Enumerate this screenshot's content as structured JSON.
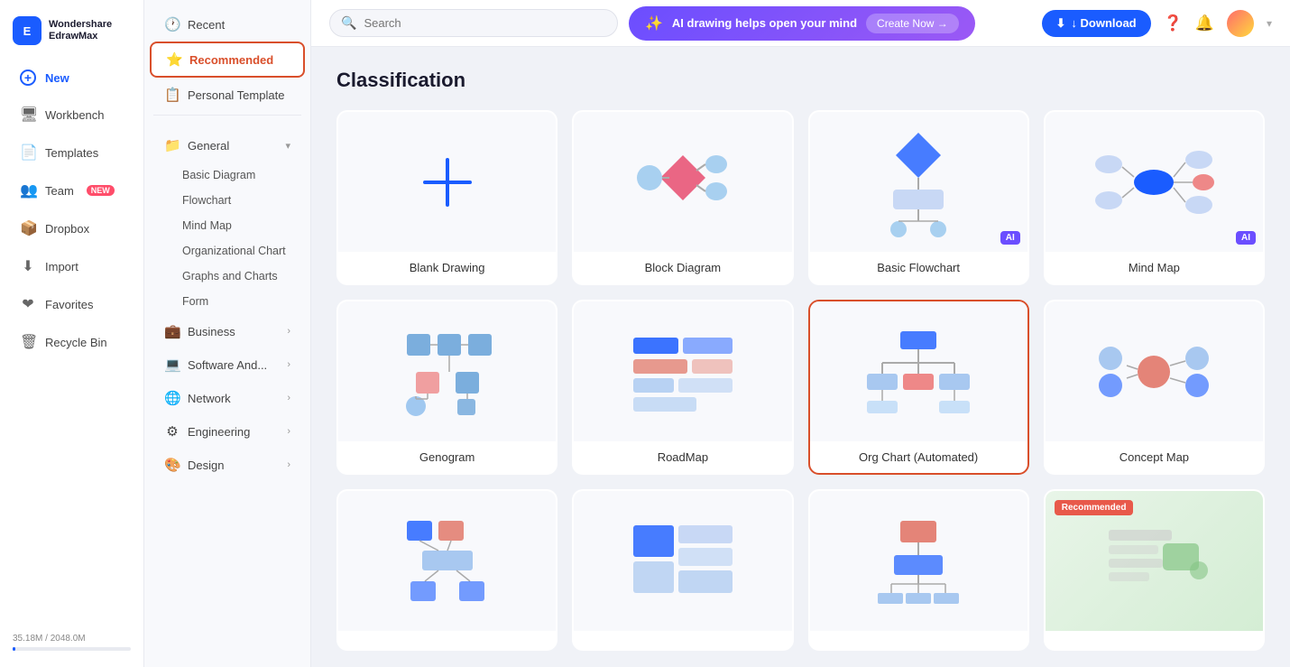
{
  "app": {
    "name": "Wondershare",
    "subtitle": "EdrawMax",
    "logo_text_line1": "Wondershare",
    "logo_text_line2": "EdrawMax"
  },
  "sidebar": {
    "items": [
      {
        "id": "new",
        "label": "New",
        "icon": "+"
      },
      {
        "id": "workbench",
        "label": "Workbench",
        "icon": "🖥"
      },
      {
        "id": "templates",
        "label": "Templates",
        "icon": "📄"
      },
      {
        "id": "team",
        "label": "Team",
        "icon": "👥",
        "badge": "NEW"
      },
      {
        "id": "dropbox",
        "label": "Dropbox",
        "icon": "📦"
      },
      {
        "id": "import",
        "label": "Import",
        "icon": "⬇"
      },
      {
        "id": "favorites",
        "label": "Favorites",
        "icon": "❤"
      },
      {
        "id": "recycle",
        "label": "Recycle Bin",
        "icon": "🗑"
      }
    ],
    "storage": {
      "label": "35.18M / 2048.0M",
      "percent": 2
    }
  },
  "middle_panel": {
    "items": [
      {
        "id": "recent",
        "label": "Recent",
        "icon": "🕐",
        "active": false
      },
      {
        "id": "recommended",
        "label": "Recommended",
        "icon": "⭐",
        "active": true
      },
      {
        "id": "personal",
        "label": "Personal Template",
        "icon": "📋",
        "active": false
      }
    ],
    "sections": [
      {
        "id": "general",
        "label": "General",
        "icon": "📁",
        "expanded": true,
        "sub_items": [
          "Basic Diagram",
          "Flowchart",
          "Mind Map",
          "Organizational Chart",
          "Graphs and Charts",
          "Form"
        ]
      },
      {
        "id": "business",
        "label": "Business",
        "icon": "💼",
        "has_chevron": true
      },
      {
        "id": "software",
        "label": "Software And...",
        "icon": "💻",
        "has_chevron": true
      },
      {
        "id": "network",
        "label": "Network",
        "icon": "🌐",
        "has_chevron": true
      },
      {
        "id": "engineering",
        "label": "Engineering",
        "icon": "⚙",
        "has_chevron": true
      },
      {
        "id": "design",
        "label": "Design",
        "icon": "🎨",
        "has_chevron": true
      }
    ]
  },
  "header": {
    "search_placeholder": "Search",
    "ai_banner_text": "AI drawing helps open your mind",
    "ai_create_label": "Create Now →",
    "download_label": "↓  Download"
  },
  "content": {
    "title": "Classification",
    "cards": [
      {
        "id": "blank",
        "label": "Blank Drawing",
        "type": "blank",
        "ai": false,
        "selected": false,
        "recommended": false
      },
      {
        "id": "block",
        "label": "Block Diagram",
        "type": "block",
        "ai": false,
        "selected": false,
        "recommended": false
      },
      {
        "id": "flowchart",
        "label": "Basic Flowchart",
        "type": "flowchart",
        "ai": true,
        "selected": false,
        "recommended": false
      },
      {
        "id": "mindmap",
        "label": "Mind Map",
        "type": "mindmap",
        "ai": true,
        "selected": false,
        "recommended": false
      },
      {
        "id": "genogram",
        "label": "Genogram",
        "type": "genogram",
        "ai": false,
        "selected": false,
        "recommended": false
      },
      {
        "id": "roadmap",
        "label": "RoadMap",
        "type": "roadmap",
        "ai": false,
        "selected": false,
        "recommended": false
      },
      {
        "id": "orgchart",
        "label": "Org Chart (Automated)",
        "type": "orgchart",
        "ai": false,
        "selected": true,
        "recommended": false
      },
      {
        "id": "conceptmap",
        "label": "Concept Map",
        "type": "conceptmap",
        "ai": false,
        "selected": false,
        "recommended": false
      },
      {
        "id": "network1",
        "label": "",
        "type": "network1",
        "ai": false,
        "selected": false,
        "recommended": false
      },
      {
        "id": "treemap",
        "label": "",
        "type": "treemap",
        "ai": false,
        "selected": false,
        "recommended": false
      },
      {
        "id": "swimlane",
        "label": "",
        "type": "swimlane",
        "ai": false,
        "selected": false,
        "recommended": false
      },
      {
        "id": "recommended_card",
        "label": "",
        "type": "recommended_visual",
        "ai": false,
        "selected": false,
        "recommended": true
      }
    ]
  }
}
